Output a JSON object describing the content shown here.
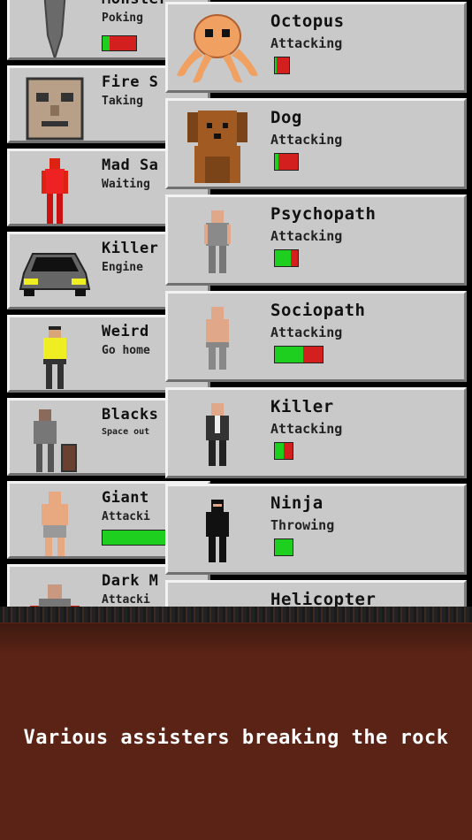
{
  "left_column": [
    {
      "name": "Monster",
      "status": "Poking",
      "bar": {
        "green": 0,
        "red": 1
      }
    },
    {
      "name": "Fire S",
      "status": "Taking",
      "bar": null
    },
    {
      "name": "Mad Sa",
      "status": "Waiting",
      "bar": null
    },
    {
      "name": "Killer",
      "status": "Engine",
      "bar": null
    },
    {
      "name": "Weird",
      "status": "Go home",
      "bar": null
    },
    {
      "name": "Blacks",
      "status": "Space out",
      "bar": null
    },
    {
      "name": "Giant",
      "status": "Attacki",
      "bar": {
        "green": 1,
        "red": 0
      }
    },
    {
      "name": "Dark M",
      "status": "Attacki",
      "bar": null
    }
  ],
  "right_column": [
    {
      "name": "Octopus",
      "status": "Attacking",
      "bar": {
        "green": 0.1,
        "red": 0.9
      }
    },
    {
      "name": "Dog",
      "status": "Attacking",
      "bar": {
        "green": 0.15,
        "red": 0.85
      }
    },
    {
      "name": "Psychopath",
      "status": "Attacking",
      "bar": {
        "green": 0.7,
        "red": 0.3
      }
    },
    {
      "name": "Sociopath",
      "status": "Attacking",
      "bar": {
        "green": 0.6,
        "red": 0.4
      }
    },
    {
      "name": "Killer",
      "status": "Attacking",
      "bar": {
        "green": 0.5,
        "red": 0.5
      }
    },
    {
      "name": "Ninja",
      "status": "Throwing",
      "bar": {
        "green": 1.0,
        "red": 0
      }
    },
    {
      "name": "Helicopter",
      "status": "",
      "bar": null
    }
  ],
  "caption": "Various assisters breaking the rock",
  "colors": {
    "bar_green": "#1fcf1f",
    "bar_red": "#d41f1f",
    "card_bg": "#c9c9c9",
    "ground": "#5a2316"
  }
}
